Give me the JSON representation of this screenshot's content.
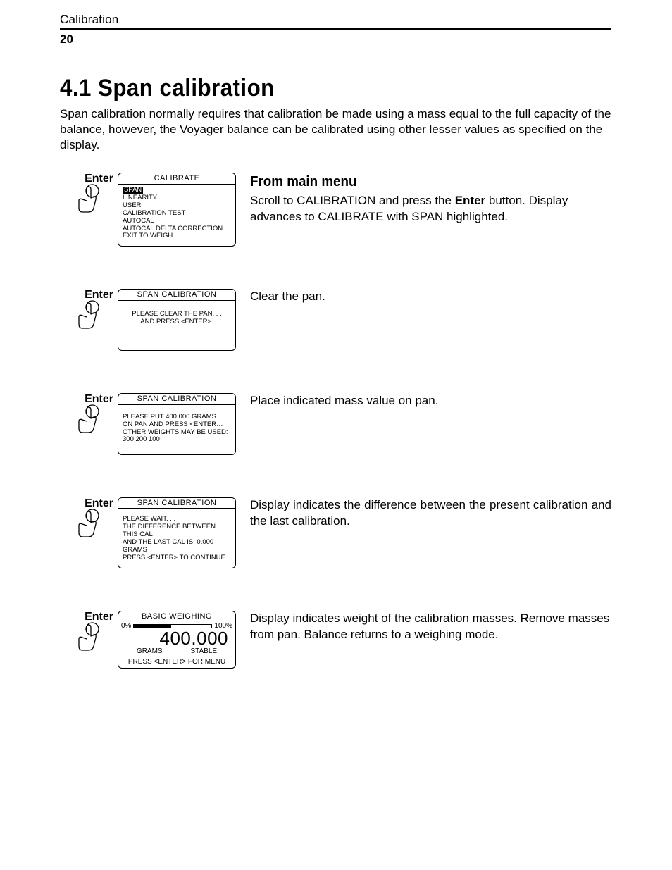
{
  "header": {
    "section_label": "Calibration",
    "page_number": "20"
  },
  "section": {
    "title": "4.1  Span calibration",
    "intro": "Span calibration normally requires that calibration be made using a mass equal to the full capacity of the balance, however, the Voyager balance can be calibrated using other lesser values as specified on the display."
  },
  "enter_label": "Enter",
  "steps": [
    {
      "lcd": {
        "title": "CALIBRATE",
        "highlight": "SPAN",
        "lines": [
          "LINEARITY",
          "USER",
          "CALIBRATION TEST",
          "AUTOCAL",
          "AUTOCAL DELTA CORRECTION",
          "EXIT TO WEIGH"
        ]
      },
      "subhead": "From  main  menu",
      "text_parts": {
        "p1a": "Scroll to CALIBRATION and press the ",
        "bold": "Enter",
        "p1b": " button. Display advances to CALIBRATE with SPAN highlighted."
      }
    },
    {
      "lcd": {
        "title": "SPAN  CALIBRATION",
        "lines": [
          "PLEASE CLEAR THE PAN. . .",
          "   AND PRESS <ENTER>."
        ]
      },
      "text": "Clear the pan."
    },
    {
      "lcd": {
        "title": "SPAN  CALIBRATION",
        "lines": [
          "PLEASE PUT 400.000 GRAMS",
          "ON PAN AND PRESS <ENTER…",
          "OTHER WEIGHTS MAY BE USED:",
          "300 200 100"
        ]
      },
      "text": "Place indicated mass value on pan."
    },
    {
      "lcd": {
        "title": "SPAN  CALIBRATION",
        "lines": [
          "PLEASE WAIT. . .",
          "THE DIFFERENCE BETWEEN THIS CAL",
          "AND THE LAST CAL IS: 0.000 GRAMS",
          "PRESS <ENTER> TO CONTINUE"
        ]
      },
      "text": "Display indicates the difference between the present calibration and the last calibration.",
      "justify": true
    },
    {
      "lcd_basic": {
        "title": "BASIC WEIGHING",
        "pct_left": "0%",
        "pct_right": "100%",
        "value": "400.000",
        "units": "GRAMS",
        "status": "STABLE",
        "footer": "PRESS <ENTER> FOR MENU",
        "fill_pct": 48
      },
      "text": "Display indicates weight of the calibration masses. Remove masses from pan. Balance returns to a weighing mode."
    }
  ]
}
